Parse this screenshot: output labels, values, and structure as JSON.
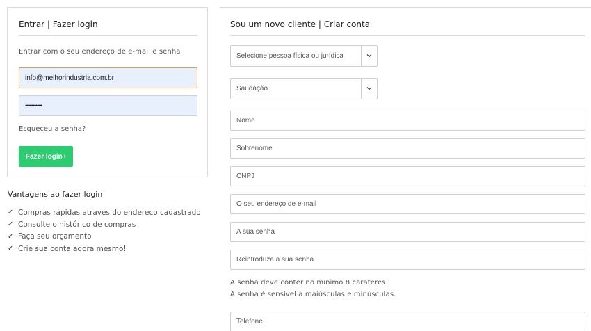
{
  "login": {
    "title": "Entrar | Fazer login",
    "subtitle": "Entrar com o seu endereço de e-mail e senha",
    "email_value": "info@melhorindustria.com.br",
    "password_value": "•••••••••••",
    "forgot_link": "Esqueceu a senha?",
    "submit_label": "Fazer login",
    "submit_arrow": "›"
  },
  "advantages": {
    "title": "Vantagens ao fazer login",
    "check_glyph": "✓",
    "items": [
      "Compras rápidas através do endereço cadastrado",
      "Consulte o histórico de compras",
      "Faça seu orçamento",
      "Crie sua conta agora mesmo!"
    ]
  },
  "register": {
    "title": "Sou um novo cliente | Criar conta",
    "person_type_select": "Selecione pessoa física ou jurídica",
    "salutation_select": "Saudação",
    "fields": {
      "first_name": "Nome",
      "last_name": "Sobrenome",
      "cnpj": "CNPJ",
      "email": "O seu endereço de e-mail",
      "password": "A sua senha",
      "password_repeat": "Reintroduza a sua senha",
      "phone": "Telefone"
    },
    "password_hint_1": "A senha deve conter no mínimo 8 carateres.",
    "password_hint_2": "A senha é sensível a maiúsculas e minúsculas."
  },
  "colors": {
    "accent_green": "#2ecc71",
    "focus_orange": "#e59a4a",
    "autofill_blue": "#e8f0fe"
  },
  "icons": {
    "select_chevron": "chevron-down-icon",
    "submit_arrow": "chevron-right-icon",
    "check": "check-icon"
  }
}
